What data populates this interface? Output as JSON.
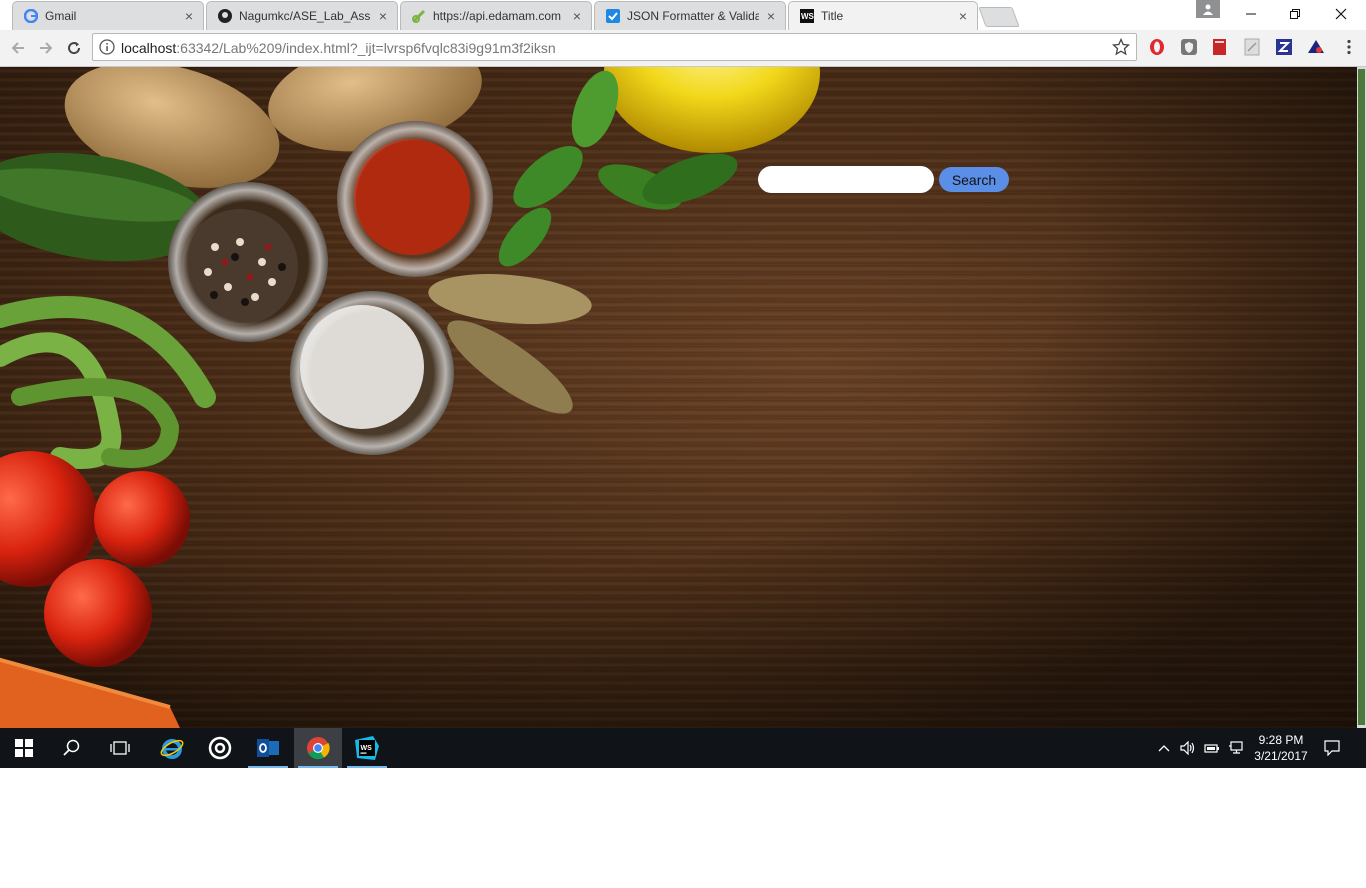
{
  "browser": {
    "tabs": [
      {
        "label": "Gmail",
        "icon": "gmail-icon",
        "active": false
      },
      {
        "label": "Nagumkc/ASE_Lab_Assig",
        "icon": "github-icon",
        "active": false
      },
      {
        "label": "https://api.edamam.com",
        "icon": "link-icon",
        "active": false
      },
      {
        "label": "JSON Formatter & Valida",
        "icon": "checkbox-icon",
        "active": false
      },
      {
        "label": "Title",
        "icon": "webstorm-icon",
        "active": true
      }
    ],
    "address": {
      "host": "localhost",
      "rest": ":63342/Lab%209/index.html?_ijt=lvrsp6fvqlc83i9g91m3f2iksn"
    }
  },
  "page": {
    "search": {
      "placeholder": "",
      "value": "",
      "button_label": "Search",
      "button_color": "#5b8ee6"
    }
  },
  "taskbar": {
    "clock": {
      "time": "9:28 PM",
      "date": "3/21/2017"
    }
  }
}
